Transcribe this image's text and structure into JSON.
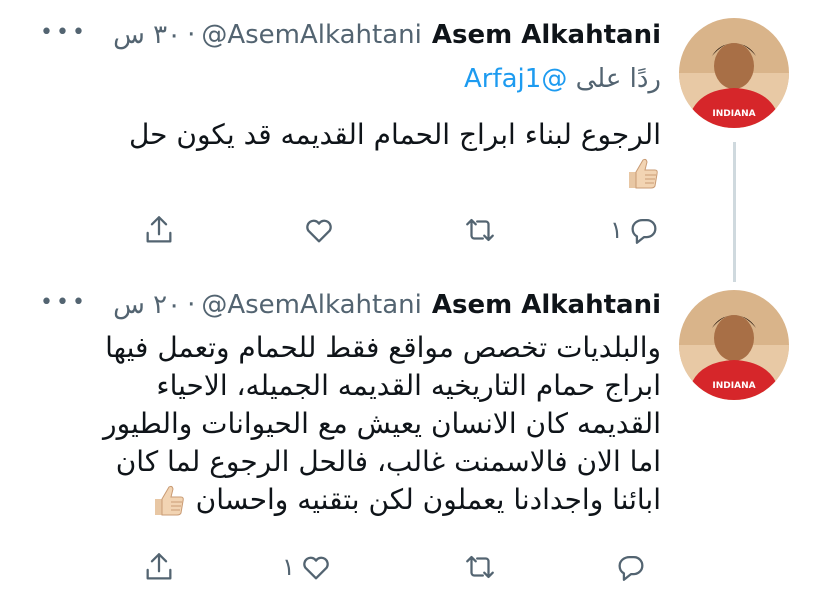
{
  "tweets": [
    {
      "display_name": "Asem Alkahtani",
      "handle": "@AsemAlkahtani",
      "time": "٣٠ س",
      "reply_prefix": "ردًا على",
      "reply_mention": "@Arfaj1",
      "text_lines": [
        "الرجوع لبناء ابراج الحمام القديمه قد يكون حل"
      ],
      "replies": "١",
      "retweets": "",
      "likes": ""
    },
    {
      "display_name": "Asem Alkahtani",
      "handle": "@AsemAlkahtani",
      "time": "٢٠ س",
      "text_lines": [
        "والبلديات تخصص مواقع فقط للحمام وتعمل فيها",
        "ابراج حمام التاريخيه القديمه الجميله، الاحياء",
        "القديمه كان الانسان يعيش مع الحيوانات والطيور",
        "اما الان فالاسمنت غالب، فالحل الرجوع لما كان",
        "ابائنا واجدادنا يعملون لكن بتقنيه واحسان"
      ],
      "replies": "",
      "retweets": "",
      "likes": "١"
    }
  ],
  "icons": {
    "more": "more-icon",
    "reply": "reply-icon",
    "retweet": "retweet-icon",
    "like": "like-icon",
    "share": "share-icon",
    "emoji": "thumbs-up-emoji"
  },
  "colors": {
    "text": "#0f1419",
    "secondary": "#536471",
    "link": "#1d9bf0",
    "thread_line": "#cfd9de"
  }
}
